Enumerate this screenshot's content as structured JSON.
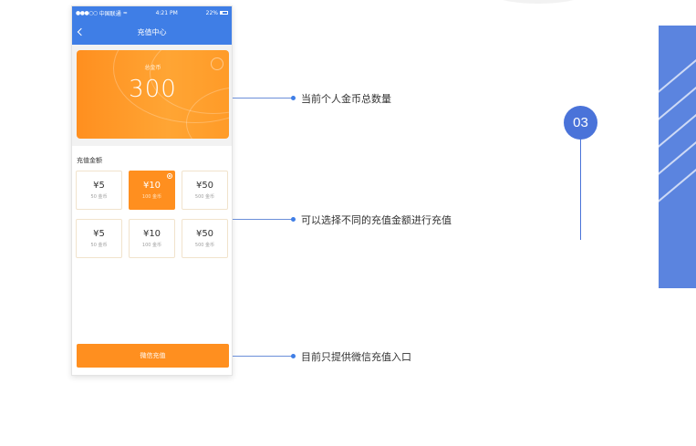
{
  "status_bar": {
    "signal": "●●●○○",
    "carrier": "中国联通",
    "wifi": "wifi-icon",
    "time": "4:21 PM",
    "battery": "22%"
  },
  "nav": {
    "title": "充值中心",
    "back_icon": "chevron-left-icon"
  },
  "coin_card": {
    "label": "总金币",
    "value": "300"
  },
  "recharge": {
    "section_title": "充值金额",
    "options": [
      {
        "amount": "¥5",
        "coins": "50 金币",
        "selected": false
      },
      {
        "amount": "¥10",
        "coins": "100 金币",
        "selected": true
      },
      {
        "amount": "¥50",
        "coins": "500 金币",
        "selected": false
      },
      {
        "amount": "¥5",
        "coins": "50 金币",
        "selected": false
      },
      {
        "amount": "¥10",
        "coins": "100 金币",
        "selected": false
      },
      {
        "amount": "¥50",
        "coins": "500 金币",
        "selected": false
      }
    ],
    "pay_button": "微信充值"
  },
  "annotations": {
    "coin_total": "当前个人金币总数量",
    "amount_select": "可以选择不同的充值金额进行充值",
    "pay_entry": "目前只提供微信充值入口"
  },
  "step": {
    "number": "03"
  },
  "colors": {
    "brand_blue": "#3f7ee6",
    "accent_orange": "#ff8f1f",
    "panel_blue": "#5b84df"
  }
}
